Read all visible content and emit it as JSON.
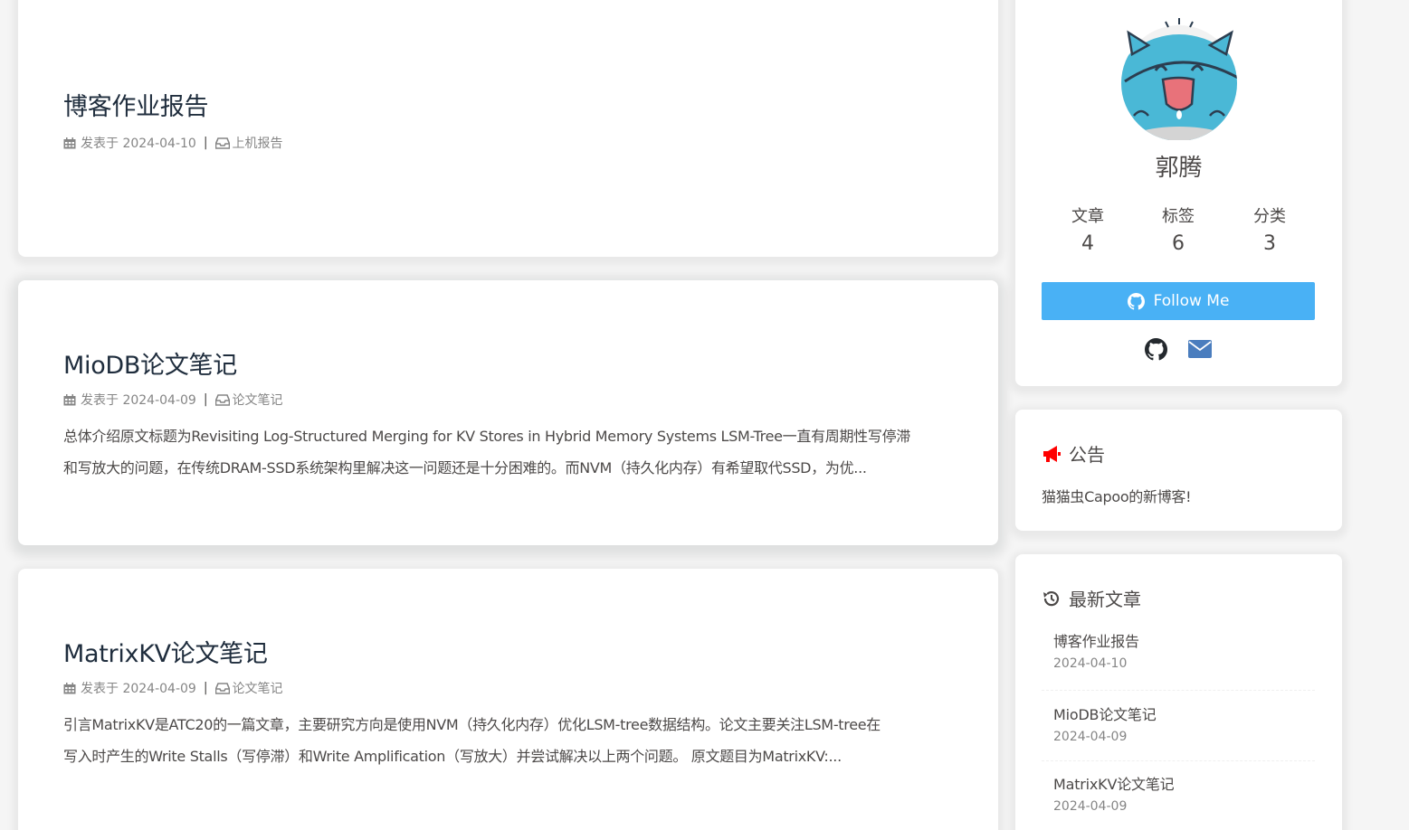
{
  "posts": [
    {
      "title": "博客作业报告",
      "date_label": "发表于 2024-04-10",
      "separator": "|",
      "category": "上机报告",
      "excerpt": []
    },
    {
      "title": "MioDB论文笔记",
      "date_label": "发表于 2024-04-09",
      "separator": "|",
      "category": "论文笔记",
      "excerpt": [
        "总体介绍原文标题为Revisiting Log-Structured Merging for KV Stores in Hybrid Memory Systems LSM-Tree一直有周期性写停滞",
        "和写放大的问题，在传统DRAM-SSD系统架构里解决这一问题还是十分困难的。而NVM（持久化内存）有希望取代SSD，为优..."
      ]
    },
    {
      "title": "MatrixKV论文笔记",
      "date_label": "发表于 2024-04-09",
      "separator": "|",
      "category": "论文笔记",
      "excerpt": [
        "引言MatrixKV是ATC20的一篇文章，主要研究方向是使用NVM（持久化内存）优化LSM-tree数据结构。论文主要关注LSM-tree在",
        "写入时产生的Write Stalls（写停滞）和Write Amplification（写放大）并尝试解决以上两个问题。 原文题目为MatrixKV:..."
      ]
    }
  ],
  "author": {
    "name": "郭腾",
    "stats": [
      {
        "label": "文章",
        "value": "4"
      },
      {
        "label": "标签",
        "value": "6"
      },
      {
        "label": "分类",
        "value": "3"
      }
    ],
    "follow_label": "Follow Me",
    "social_icons": [
      "github-icon",
      "envelope-icon"
    ]
  },
  "announcement": {
    "heading": "公告",
    "text": "猫猫虫Capoo的新博客!"
  },
  "recent": {
    "heading": "最新文章",
    "items": [
      {
        "title": "博客作业报告",
        "date": "2024-04-10"
      },
      {
        "title": "MioDB论文笔记",
        "date": "2024-04-09"
      },
      {
        "title": "MatrixKV论文笔记",
        "date": "2024-04-09"
      }
    ]
  },
  "colors": {
    "accent": "#49b1f5",
    "megaphone": "#ff0000",
    "text": "#4c4948",
    "meta": "#858585"
  }
}
